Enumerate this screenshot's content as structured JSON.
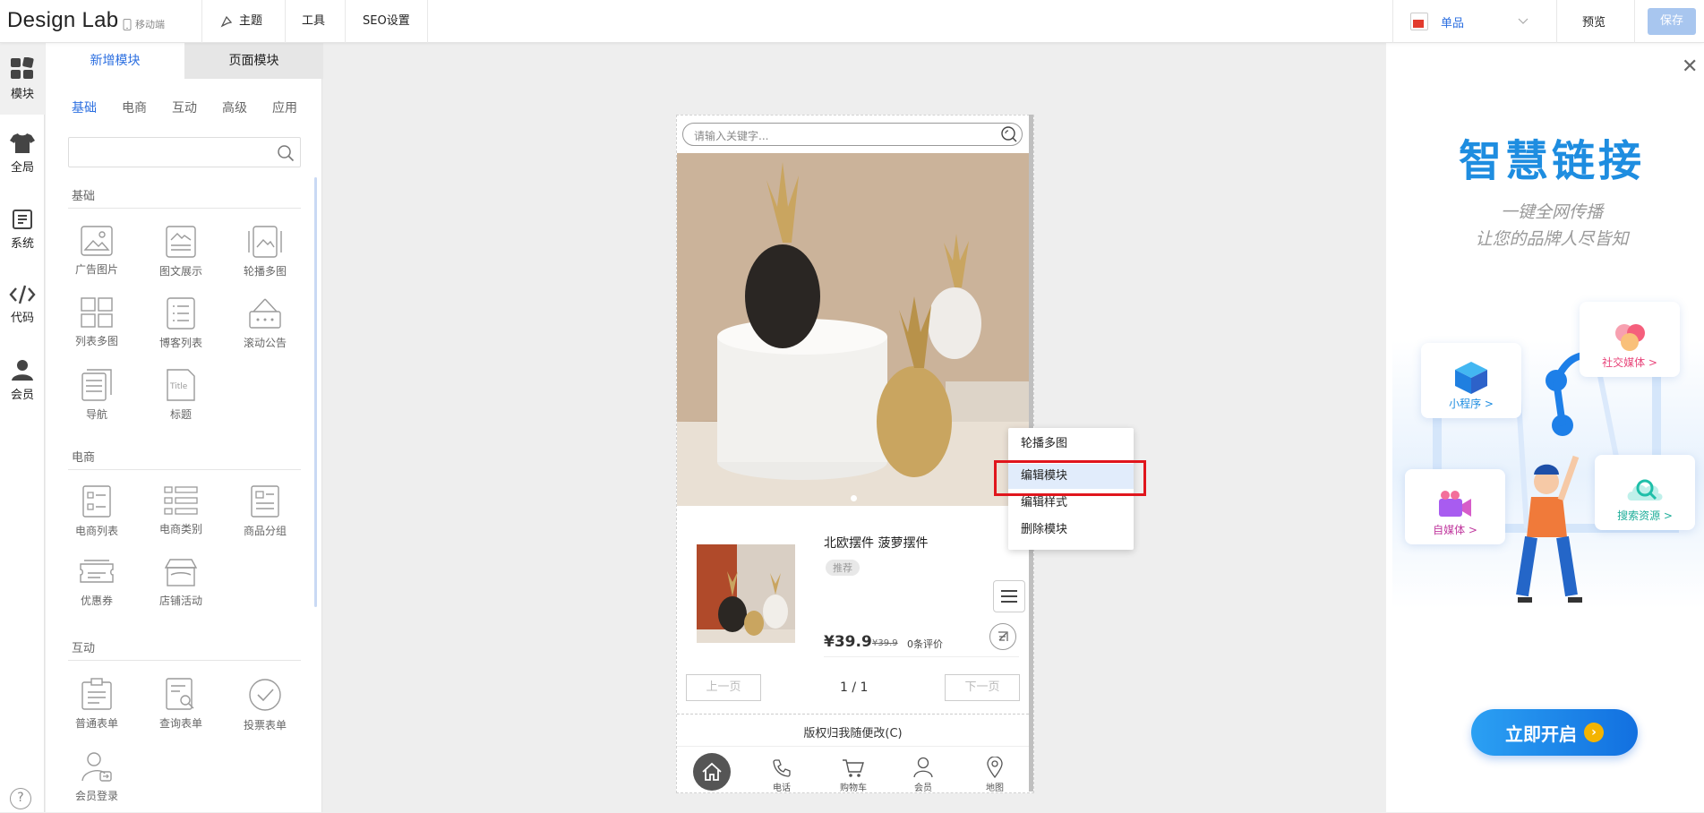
{
  "topbar": {
    "brand": "Design Lab",
    "device": "移动端",
    "nav": [
      "主题",
      "工具",
      "SEO设置"
    ],
    "language": "单品",
    "preview": "预览",
    "save": "保存"
  },
  "iconbar": {
    "items": [
      {
        "label": "模块",
        "icon": "grid-icon"
      },
      {
        "label": "全局",
        "icon": "shirt-icon"
      },
      {
        "label": "系统",
        "icon": "document-icon"
      },
      {
        "label": "代码",
        "icon": "code-icon"
      },
      {
        "label": "会员",
        "icon": "user-icon"
      }
    ],
    "help": "?"
  },
  "panel": {
    "tabs": [
      "新增模块",
      "页面模块"
    ],
    "categories": [
      "基础",
      "电商",
      "互动",
      "高级",
      "应用"
    ],
    "sections": [
      {
        "title": "基础",
        "modules": [
          "广告图片",
          "图文展示",
          "轮播多图",
          "列表多图",
          "博客列表",
          "滚动公告",
          "导航",
          "标题"
        ]
      },
      {
        "title": "电商",
        "modules": [
          "电商列表",
          "电商类别",
          "商品分组",
          "优惠券",
          "店铺活动"
        ]
      },
      {
        "title": "互动",
        "modules": [
          "普通表单",
          "查询表单",
          "投票表单",
          "会员登录"
        ]
      }
    ]
  },
  "phone": {
    "search_placeholder": "请输入关键字...",
    "product": {
      "title": "北欧摆件 菠萝摆件",
      "tag": "推荐",
      "price": "¥39.9",
      "old_price": "¥39.9",
      "reviews": "0条评价"
    },
    "pager": {
      "prev": "上一页",
      "current": "1 / 1",
      "next": "下一页"
    },
    "copyright": "版权归我随便改(C)",
    "bottom_nav": [
      "电话",
      "购物车",
      "会员",
      "地图"
    ]
  },
  "context_menu": {
    "items": [
      "轮播多图",
      "编辑模块",
      "编辑样式",
      "删除模块"
    ],
    "highlighted_index": 1
  },
  "ad": {
    "title": "智慧链接",
    "subtitle_1": "一键全网传播",
    "subtitle_2": "让您的品牌人尽皆知",
    "cards": [
      "小程序 >",
      "社交媒体 >",
      "自媒体 >",
      "搜索资源 >"
    ],
    "cta": "立即开启",
    "accent": "#1e8de0"
  }
}
